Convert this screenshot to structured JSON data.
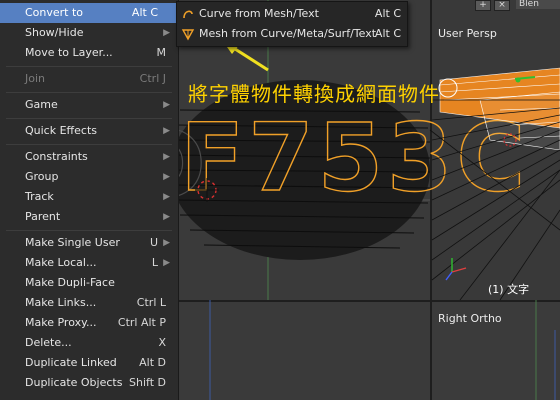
{
  "menu": {
    "items": [
      {
        "label": "Convert to",
        "shortcut": "Alt C",
        "submenu": true,
        "highlighted": true
      },
      {
        "label": "Show/Hide",
        "shortcut": "",
        "submenu": true
      },
      {
        "label": "Move to Layer...",
        "shortcut": "M",
        "submenu": false
      },
      {
        "label": "Join",
        "shortcut": "Ctrl J",
        "submenu": false,
        "disabled": true
      },
      {
        "label": "Game",
        "shortcut": "",
        "submenu": true
      },
      {
        "label": "Quick Effects",
        "shortcut": "",
        "submenu": true
      },
      {
        "label": "Constraints",
        "shortcut": "",
        "submenu": true
      },
      {
        "label": "Group",
        "shortcut": "",
        "submenu": true
      },
      {
        "label": "Track",
        "shortcut": "",
        "submenu": true
      },
      {
        "label": "Parent",
        "shortcut": "",
        "submenu": true
      },
      {
        "label": "Make Single User",
        "shortcut": "U",
        "submenu": true
      },
      {
        "label": "Make Local...",
        "shortcut": "L",
        "submenu": true
      },
      {
        "label": "Make Dupli-Face",
        "shortcut": "",
        "submenu": false
      },
      {
        "label": "Make Links...",
        "shortcut": "Ctrl L",
        "submenu": false
      },
      {
        "label": "Make Proxy...",
        "shortcut": "Ctrl Alt P",
        "submenu": false
      },
      {
        "label": "Delete...",
        "shortcut": "X",
        "submenu": false
      },
      {
        "label": "Duplicate Linked",
        "shortcut": "Alt D",
        "submenu": false
      },
      {
        "label": "Duplicate Objects",
        "shortcut": "Shift D",
        "submenu": false
      }
    ]
  },
  "submenu": {
    "items": [
      {
        "label": "Curve from Mesh/Text",
        "shortcut": "Alt C",
        "icon": "curve-icon"
      },
      {
        "label": "Mesh from Curve/Meta/Surf/Text",
        "shortcut": "Alt C",
        "icon": "mesh-icon"
      }
    ]
  },
  "viewports": {
    "persp_label": "User Persp",
    "ortho_label": "Right Ortho",
    "frame_label": "(1) 文字"
  },
  "annotation": {
    "text": "將字體物件轉換成網面物件",
    "color": "#ffd200"
  },
  "scene": {
    "text_object": "F753C",
    "text_color": "#f0a028",
    "highlight_color": "#5680c2"
  },
  "header": {
    "top_right_label": "Blen"
  }
}
